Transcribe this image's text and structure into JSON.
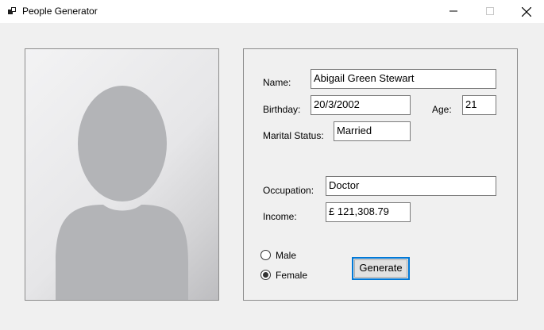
{
  "window": {
    "title": "People Generator",
    "icons": {
      "app": "app-icon",
      "minimize": "minimize-icon",
      "maximize": "maximize-icon",
      "close": "close-icon"
    }
  },
  "photo": {
    "icon": "person-silhouette-icon"
  },
  "form": {
    "name": {
      "label": "Name:",
      "value": "Abigail Green Stewart"
    },
    "birthday": {
      "label": "Birthday:",
      "value": "20/3/2002"
    },
    "age": {
      "label": "Age:",
      "value": "21"
    },
    "marital_status": {
      "label": "Marital Status:",
      "value": "Married"
    },
    "occupation": {
      "label": "Occupation:",
      "value": "Doctor"
    },
    "income": {
      "label": "Income:",
      "value": "£ 121,308.79"
    }
  },
  "gender": {
    "options": [
      {
        "label": "Male",
        "selected": false
      },
      {
        "label": "Female",
        "selected": true
      }
    ]
  },
  "actions": {
    "generate_label": "Generate"
  },
  "colors": {
    "accent": "#0078d7",
    "background": "#f0f0f0",
    "silhouette": "#b3b4b7"
  }
}
